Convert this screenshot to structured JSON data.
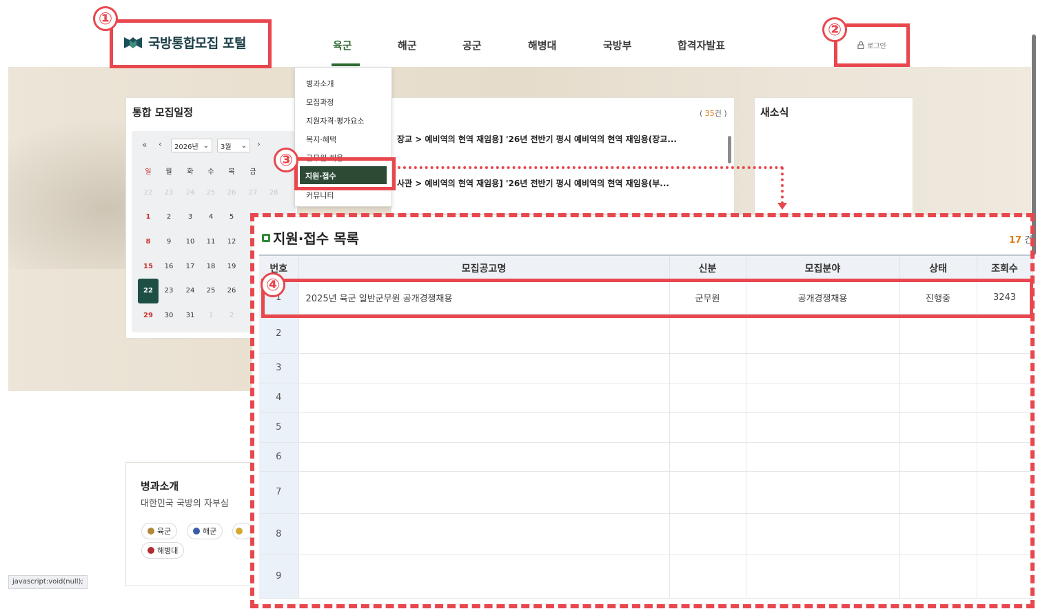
{
  "header": {
    "logo_text": "국방통합모집 포털",
    "nav": [
      "육군",
      "해군",
      "공군",
      "해병대",
      "국방부",
      "합격자발표"
    ],
    "login_label": "로그인"
  },
  "dropdown": {
    "items": [
      "병과소개",
      "모집과정",
      "지원자격·평가요소",
      "복지·혜택",
      "군무원 채용",
      "지원·접수",
      "커뮤니티"
    ],
    "active_label": "지원·접수"
  },
  "schedule": {
    "title": "통합 모집일정",
    "year": "2026년",
    "month": "3월",
    "nav_prev_year": "«",
    "nav_prev": "‹",
    "nav_next": "›",
    "weekdays": [
      "일",
      "월",
      "화",
      "수",
      "목",
      "금"
    ],
    "rows": [
      [
        "22",
        "23",
        "24",
        "25",
        "26",
        "27",
        "28"
      ],
      [
        "1",
        "2",
        "3",
        "4",
        "5"
      ],
      [
        "8",
        "9",
        "10",
        "11",
        "12"
      ],
      [
        "15",
        "16",
        "17",
        "18",
        "19"
      ],
      [
        "22",
        "23",
        "24",
        "25",
        "26"
      ],
      [
        "29",
        "30",
        "31",
        "1",
        "2"
      ]
    ]
  },
  "notice_panel": {
    "count_open": "( ",
    "count": "35",
    "count_close": "건 )",
    "lines": [
      "장교 > 예비역의 현역 재임용] '26년 전반기 평시 예비역의 현역 재임용(장교...",
      "사관 > 예비역의 현역 재임용] '26년 전반기 평시 예비역의 현역 재임용(부..."
    ]
  },
  "news_panel": {
    "title": "새소식"
  },
  "intro_card": {
    "title": "병과소개",
    "subtitle": "대한민국 국방의 자부심",
    "tags": [
      "육군",
      "해군",
      "해병대"
    ]
  },
  "status_bar": "javascript:void(null);",
  "callouts": [
    "①",
    "②",
    "③",
    "④"
  ],
  "application_list": {
    "title": "지원·접수 목록",
    "count": "17",
    "count_unit": "건",
    "columns": [
      "번호",
      "모집공고명",
      "신분",
      "모집분야",
      "상태",
      "조회수"
    ],
    "rows": [
      {
        "no": "1",
        "title": "2025년 육군 일반군무원 공개경쟁채용",
        "status_type": "군무원",
        "field": "공개경쟁채용",
        "state": "진행중",
        "views": "3243"
      },
      {
        "no": "2",
        "title": "",
        "status_type": "",
        "field": "",
        "state": "",
        "views": ""
      },
      {
        "no": "3",
        "title": "",
        "status_type": "",
        "field": "",
        "state": "",
        "views": ""
      },
      {
        "no": "4",
        "title": "",
        "status_type": "",
        "field": "",
        "state": "",
        "views": ""
      },
      {
        "no": "5",
        "title": "",
        "status_type": "",
        "field": "",
        "state": "",
        "views": ""
      },
      {
        "no": "6",
        "title": "",
        "status_type": "",
        "field": "",
        "state": "",
        "views": ""
      },
      {
        "no": "7",
        "title": "",
        "status_type": "",
        "field": "",
        "state": "",
        "views": ""
      },
      {
        "no": "8",
        "title": "",
        "status_type": "",
        "field": "",
        "state": "",
        "views": ""
      },
      {
        "no": "9",
        "title": "",
        "status_type": "",
        "field": "",
        "state": "",
        "views": ""
      }
    ]
  },
  "colors": {
    "brand_green": "#2f6a32",
    "callout_red": "#e8474d",
    "count_orange": "#e07a10",
    "today_bg": "#1e4f47"
  },
  "icons": [
    "logo-icon",
    "lock-icon",
    "square-list-icon"
  ]
}
